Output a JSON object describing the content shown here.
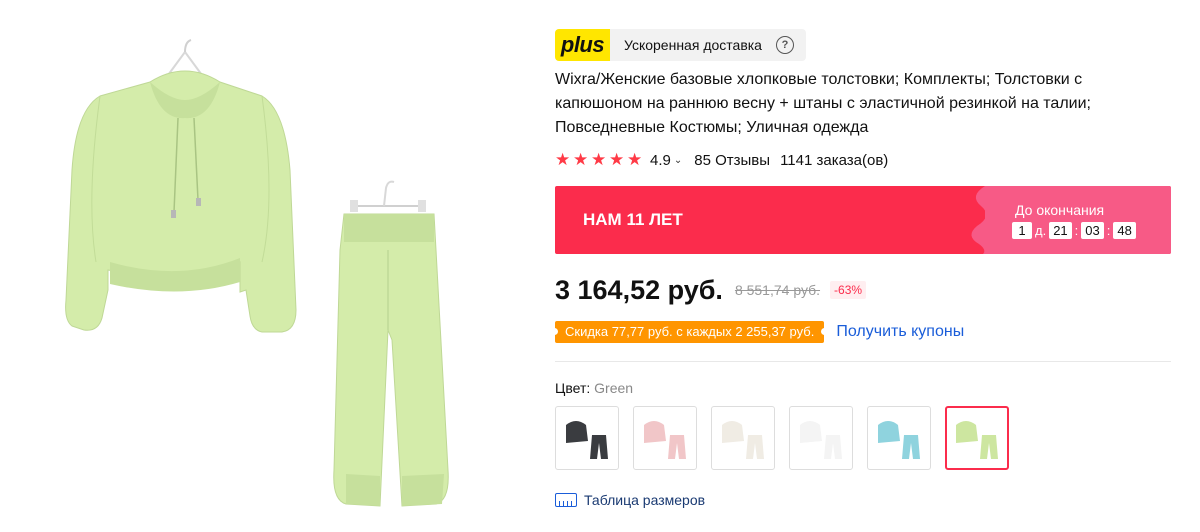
{
  "gallery": {
    "hoodie_color": "#d4ecaa",
    "hoodie_shade": "#c6e09c",
    "pants_color": "#d4ecaa"
  },
  "delivery": {
    "badge": "plus",
    "text": "Ускоренная доставка",
    "help": "?"
  },
  "product": {
    "title": "Wixra/Женские базовые хлопковые толстовки; Комплекты; Толстовки с капюшоном на раннюю весну + штаны с эластичной резинкой на талии; Повседневные Костюмы; Уличная одежда",
    "rating": "4.9",
    "reviews": "85 Отзывы",
    "orders": "1141 заказа(ов)"
  },
  "promo": {
    "label": "НАМ 11 ЛЕТ",
    "countdown_title": "До окончания",
    "days": "1",
    "days_unit": "д.",
    "hours": "21",
    "minutes": "03",
    "seconds": "48",
    "sep": ":",
    "bg_color": "#fb2c4c",
    "timer_bg": "#f75a86"
  },
  "price": {
    "current": "3 164,52 руб.",
    "old": "8 551,74 руб.",
    "discount": "-63%"
  },
  "coupon": {
    "tag": "Скидка 77,77 руб. с каждых 2 255,37 руб.",
    "link": "Получить купоны"
  },
  "color": {
    "label": "Цвет:",
    "value": "Green",
    "swatches": [
      {
        "name": "black",
        "color": "#3a3c40"
      },
      {
        "name": "pink",
        "color": "#f1c6c8"
      },
      {
        "name": "cream",
        "color": "#f0ece4"
      },
      {
        "name": "white",
        "color": "#f4f4f4"
      },
      {
        "name": "blue",
        "color": "#8fd3de"
      },
      {
        "name": "green",
        "color": "#cde6a0"
      }
    ]
  },
  "size_table": {
    "label": "Таблица размеров"
  }
}
